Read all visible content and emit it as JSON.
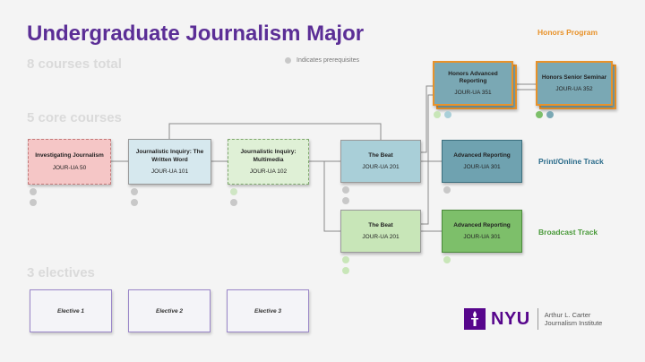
{
  "title": "Undergraduate Journalism Major",
  "honors_program_label": "Honors Program",
  "total_label": "8 courses total",
  "legend": "Indicates prerequisites",
  "core_label": "5 core courses",
  "electives_label": "3 electives",
  "courses": {
    "investigating": {
      "name": "Investigating Journalism",
      "code": "JOUR-UA 50"
    },
    "written_word": {
      "name": "Journalistic Inquiry: The Written Word",
      "code": "JOUR-UA 101"
    },
    "multimedia": {
      "name": "Journalistic Inquiry: Multimedia",
      "code": "JOUR-UA 102"
    },
    "beat_print": {
      "name": "The Beat",
      "code": "JOUR-UA 201"
    },
    "beat_broadcast": {
      "name": "The Beat",
      "code": "JOUR-UA 201"
    },
    "adv_print": {
      "name": "Advanced Reporting",
      "code": "JOUR-UA 301"
    },
    "adv_broadcast": {
      "name": "Advanced Reporting",
      "code": "JOUR-UA 301"
    },
    "honors_adv": {
      "name": "Honors Advanced Reporting",
      "code": "JOUR-UA 351"
    },
    "honors_seminar": {
      "name": "Honors Senior Seminar",
      "code": "JOUR-UA 352"
    }
  },
  "tracks": {
    "print": "Print/Online Track",
    "broadcast": "Broadcast Track"
  },
  "electives": [
    "Elective 1",
    "Elective 2",
    "Elective 3"
  ],
  "logo": {
    "brand": "NYU",
    "line1": "Arthur L. Carter",
    "line2": "Journalism Institute"
  },
  "colors": {
    "title": "#5b2e96",
    "honors": "#e8922a",
    "print_track": "#2a6b8a",
    "broadcast_track": "#4a9a3a",
    "investigating": "#f5c6c6",
    "written_word": "#d6e8ee",
    "multimedia": "#dff0d6",
    "beat_print": "#a9cfd8",
    "beat_broadcast": "#c8e6b8",
    "adv_print": "#6fa2b0",
    "adv_broadcast": "#7dbf6a",
    "honors_box": "#7aa8b4",
    "nyu_purple": "#57068c"
  }
}
